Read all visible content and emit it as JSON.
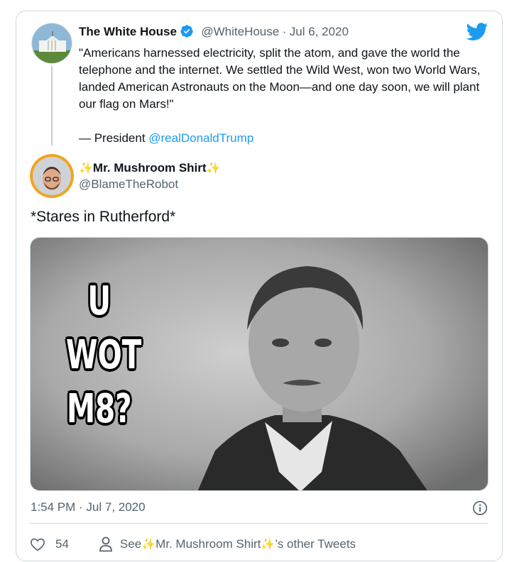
{
  "quoted_tweet": {
    "author_name": "The White House",
    "author_handle": "@WhiteHouse",
    "separator": "·",
    "date": "Jul 6, 2020",
    "text": "\"Americans harnessed electricity, split the atom, and gave the world the telephone and the internet. We settled the Wild West, won two World Wars, landed American Astronauts on the Moon—and one day soon, we will plant our flag on Mars!\"",
    "attribution_prefix": "— President ",
    "attribution_link": "@realDonaldTrump"
  },
  "tweet": {
    "author_name": "Mr. Mushroom Shirt",
    "sparkle": "✨",
    "author_handle": "@BlameTheRobot",
    "text": "*Stares in Rutherford*",
    "meme_text": [
      "U",
      "WOT",
      "M8?"
    ],
    "timestamp": "1:54 PM · Jul 7, 2020"
  },
  "actions": {
    "like_count": "54",
    "see_prefix": "See ",
    "see_suffix": "’s other Tweets"
  },
  "icons": {
    "verified": "verified-badge-icon",
    "twitter": "twitter-bird-icon",
    "like": "heart-icon",
    "profile": "person-icon",
    "info": "info-icon"
  },
  "colors": {
    "accent": "#1d9bf0",
    "text_primary": "#0f1419",
    "text_secondary": "#536471",
    "border": "#cfd9de"
  }
}
